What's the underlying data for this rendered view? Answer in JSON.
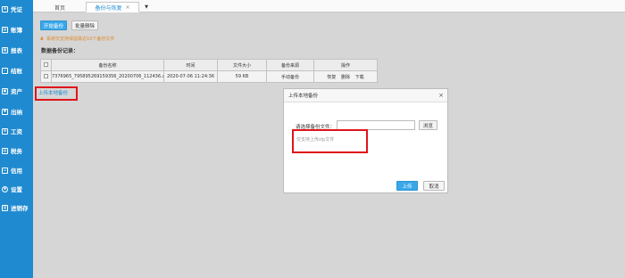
{
  "sidebar": {
    "items": [
      {
        "label": "凭证",
        "icon": "document-icon"
      },
      {
        "label": "账簿",
        "icon": "book-icon"
      },
      {
        "label": "报表",
        "icon": "report-icon"
      },
      {
        "label": "结账",
        "icon": "checkout-icon"
      },
      {
        "label": "资产",
        "icon": "asset-icon"
      },
      {
        "label": "出纳",
        "icon": "cashier-icon"
      },
      {
        "label": "工资",
        "icon": "payroll-icon"
      },
      {
        "label": "税务",
        "icon": "tax-icon"
      },
      {
        "label": "信用",
        "icon": "credit-icon"
      },
      {
        "label": "设置",
        "icon": "gear-icon"
      },
      {
        "label": "进销存",
        "icon": "inventory-icon"
      }
    ]
  },
  "tabs": {
    "home": "首页",
    "active": "备份与恢复",
    "close": "×",
    "more": "▼"
  },
  "toolbar": {
    "start_backup": "开始备份",
    "batch_delete": "批量删除"
  },
  "warning": "系统仅支持保留最近10个备份文件",
  "section_title": "数据备份记录：",
  "table": {
    "headers": [
      "",
      "备份名称",
      "时间",
      "文件大小",
      "备份来源",
      "操作"
    ],
    "rows": [
      {
        "name": "7376965_795895269159356_20200706_112436.z",
        "time": "2020-07-06 11:24:36",
        "size": "59 KB",
        "source": "手动备份",
        "actions": [
          "恢复",
          "删除",
          "下载"
        ]
      }
    ]
  },
  "upload_local_link": "上传本地备份",
  "dialog": {
    "title": "上传本地备份",
    "close": "×",
    "file_label": "请选择备份文件：",
    "file_value": "",
    "browse": "浏览",
    "hint": "仅支持上传zip文件",
    "upload": "上传",
    "cancel": "取消"
  },
  "colors": {
    "sidebar": "#1f8ad0",
    "primary_button": "#3aa7ea",
    "warning": "#e08a2a",
    "highlight": "#e0141b"
  }
}
